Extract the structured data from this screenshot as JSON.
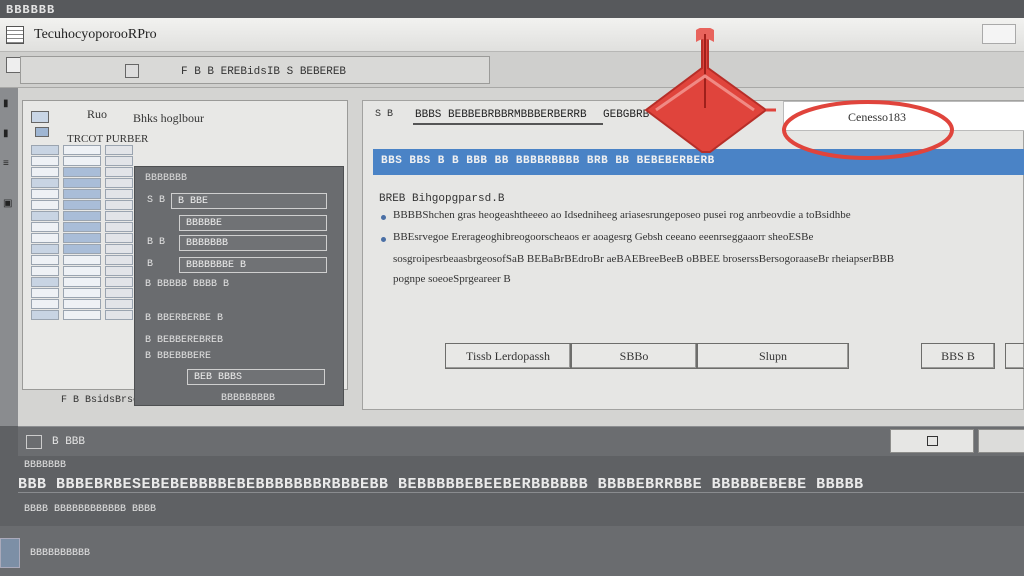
{
  "os": {
    "strip_text": "BBBBBB"
  },
  "window": {
    "title": "Tecuhocyoporoo",
    "title_suffix": "RPro"
  },
  "toolbar": {
    "text": "F B B  EREBidsIB  S BEBEREB"
  },
  "left_panel": {
    "tab": "Ruo",
    "header": "Bhks hoglbour",
    "subheader": "TRCOT PURBER",
    "status": "F B BsidsBrso"
  },
  "form": {
    "title": "BBBBBBB",
    "rows": [
      {
        "label": "S B",
        "field": "B BBE"
      },
      {
        "label": "",
        "field": "BBBBBE"
      },
      {
        "label": "B B",
        "field": "BBBBBBB"
      },
      {
        "label": "B",
        "field": "BBBBBBBE B"
      },
      {
        "label": "B BBBBB BBBB B",
        "field": ""
      },
      {
        "label": "B BBERBERBE B",
        "field": ""
      },
      {
        "label": "B BEBBEREBREB",
        "field": ""
      },
      {
        "label": "B BBEBBBERE",
        "field": ""
      },
      {
        "label": "",
        "field": "BEB BBBS"
      },
      {
        "label": "BBBBBBBBB",
        "field": ""
      }
    ]
  },
  "dialog": {
    "crumb": "S  B",
    "path_left": "BBBS BEBBEBRBBRMBBBERBERRB",
    "path_right": "GEBGBRB SREB",
    "input_value": "Cenesso183",
    "blue_bar": "BBS  BBS   B B  BBB BB  BBBBRBBBB BRB  BB   BEBEBERBERB",
    "heading": "BREB Bihgopgparsd.B",
    "bullets": [
      "BBBBShchen gras heogeashtheeeo ao Idsedniheeg ariasesrungeposeo pusei rog anrbeovdie a toBsidhbe",
      "BBEsrvegoe Ererageoghibreogoorscheaos er aoagesrg Gebsh ceeano eeenrseggaaorr sheoESBe",
      "sosgroipesrbeaasbrgeosofSaB BEBaBrBEdroBr aeBAEBreeBeeB oBBEE broserssBersogoraaseBr rheiapserBBB",
      "pognpe soeoeSprgeareer B"
    ],
    "buttons": [
      {
        "label": "Tissb Lerdopassh"
      },
      {
        "label": "SBBo"
      },
      {
        "label": "Slupn"
      },
      {
        "label": "BBS B"
      }
    ]
  },
  "annotation": {
    "color": "#e0443c"
  },
  "bottom": {
    "title": "B BBB",
    "line1": "BBBBBBB",
    "big_row": "BBB BBBEBRBESEBEBEBBBBEBEBBBBBBBRBBBEBB BEBBBBBEBEEBERBBBBBB BBBBEBRRBBE BBBBBEBEBE BBBBB",
    "line3": "BBBB BBBBBBBBBBBB BBBB",
    "line4": "BBBBBBBBBB"
  },
  "colors": {
    "blue_bar": "#4a83c6",
    "panel_dark": "#6a6c6f",
    "accent_red": "#e0443c"
  }
}
